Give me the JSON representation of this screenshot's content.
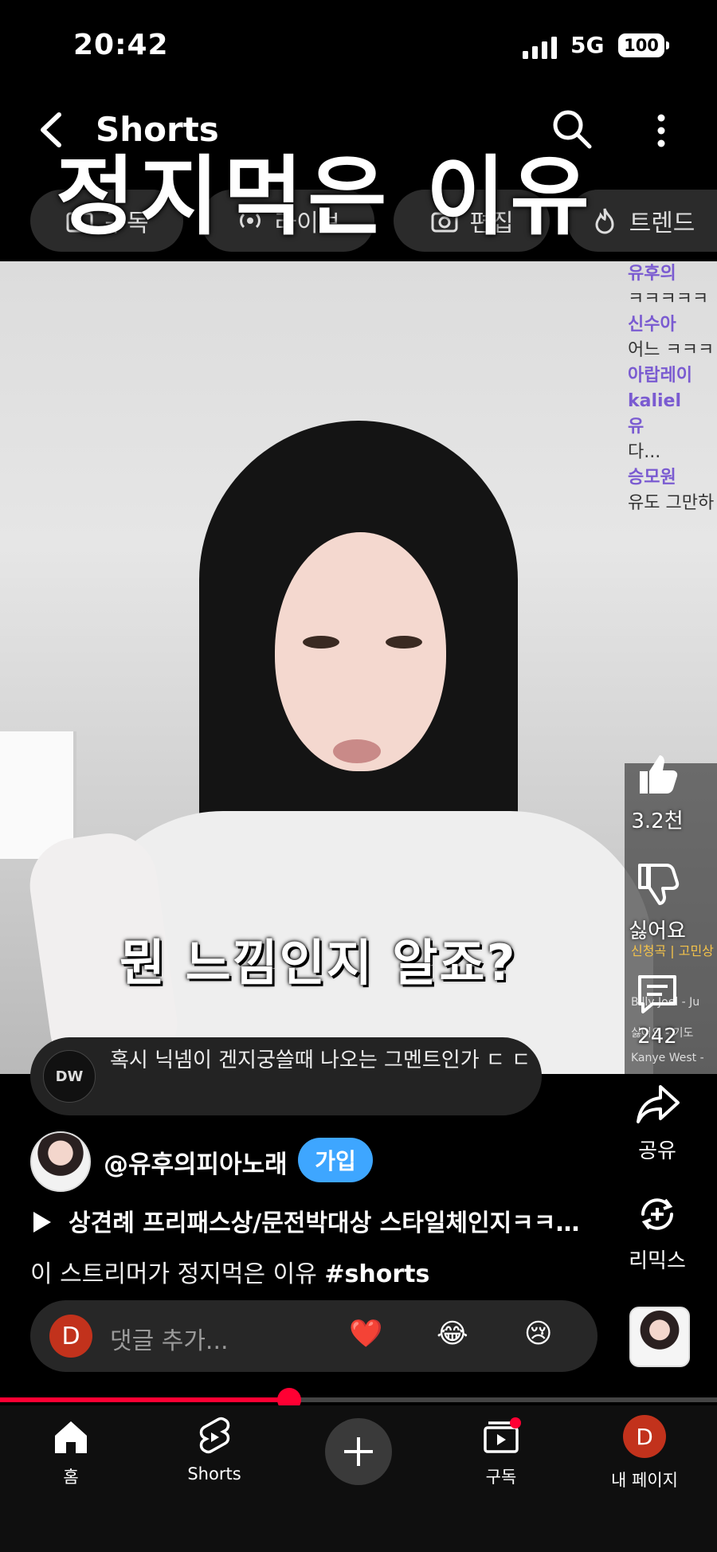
{
  "status": {
    "time": "20:42",
    "network": "5G",
    "battery": "100"
  },
  "header": {
    "title": "Shorts"
  },
  "chips": [
    {
      "label": "구독",
      "icon": "subscriptions-icon"
    },
    {
      "label": "라이브",
      "icon": "live-icon"
    },
    {
      "label": "편집",
      "icon": "camera-icon"
    },
    {
      "label": "트렌드",
      "icon": "fire-icon"
    }
  ],
  "video": {
    "title_overlay": "정지먹은 이유",
    "subtitle": "뭔 느낌인지 알죠?",
    "pinned_comment": "혹시 닉넴이 겐지궁쓸때 나오는 그멘트인가 ㄷ ㄷ",
    "pinned_avatar": "DW",
    "chat_lines": [
      {
        "user": "유후의",
        "text": "ㅋㅋㅋㅋㅋ"
      },
      {
        "user": "신수아",
        "text": "어느 ㅋㅋㅋ"
      },
      {
        "user": "아랍레이",
        "text": ""
      },
      {
        "user": "kaliel",
        "text": ""
      },
      {
        "user": "유",
        "text": "다..."
      },
      {
        "user": "승모원",
        "text": "유도 그만하"
      }
    ],
    "overlay_panel": [
      "신청곡 | 고민상",
      "Billy Joel - Ju",
      "싫어요 - 기도",
      "Kanye West - "
    ]
  },
  "actions": {
    "like_count": "3.2천",
    "dislike_label": "싫어요",
    "comments_count": "242",
    "share_label": "공유",
    "remix_label": "리믹스"
  },
  "channel": {
    "handle": "@유후의피아노래",
    "join_label": "가입"
  },
  "playlist": {
    "title": "상견례 프리패스상/문전박대상 스타일체인지ㅋㅋ…"
  },
  "description": {
    "text": "이 스트리머가 정지먹은 이유 ",
    "hashtag": "#shorts"
  },
  "comment_box": {
    "avatar_letter": "D",
    "placeholder": "댓글 추가...",
    "emojis": [
      "❤️",
      "😂",
      "😢"
    ]
  },
  "progress": {
    "fraction": 0.403
  },
  "nav": [
    {
      "label": "홈",
      "icon": "home-icon"
    },
    {
      "label": "Shorts",
      "icon": "shorts-icon"
    },
    {
      "label": "",
      "icon": "create-icon"
    },
    {
      "label": "구독",
      "icon": "subscriptions-icon"
    },
    {
      "label": "내 페이지",
      "icon": "avatar"
    }
  ],
  "me": {
    "avatar_letter": "D"
  }
}
